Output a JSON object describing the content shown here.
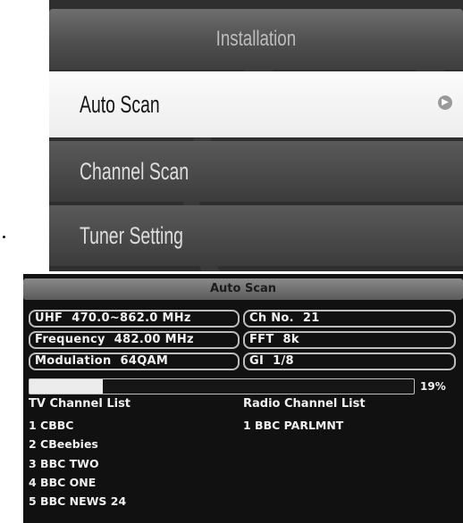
{
  "installation": {
    "title": "Installation",
    "items": [
      {
        "label": "Auto Scan",
        "selected": true
      },
      {
        "label": "Channel Scan",
        "selected": false
      },
      {
        "label": "Tuner Setting",
        "selected": false
      }
    ]
  },
  "auto_scan": {
    "title": "Auto Scan",
    "uhf": {
      "label": "UHF",
      "value": "470.0~862.0 MHz"
    },
    "ch_no": {
      "label": "Ch No.",
      "value": "21"
    },
    "frequency": {
      "label": "Frequency",
      "value": "482.00 MHz"
    },
    "fft": {
      "label": "FFT",
      "value": "8k"
    },
    "modulation": {
      "label": "Modulation",
      "value": "64QAM"
    },
    "gi": {
      "label": "GI",
      "value": "1/8"
    },
    "progress": {
      "percent_text": "19%",
      "fraction": 0.19
    },
    "tv_list": {
      "header": "TV Channel List",
      "channels": [
        "1 CBBC",
        "2 CBeebies",
        "3 BBC TWO",
        "4 BBC ONE",
        "5 BBC NEWS 24"
      ]
    },
    "radio_list": {
      "header": "Radio Channel List",
      "channels": [
        "1 BBC PARLMNT"
      ]
    }
  },
  "colors": {
    "panel_bg": "#111111",
    "selected_item": "#f4f4f4",
    "progress_fill": "#ececec"
  }
}
